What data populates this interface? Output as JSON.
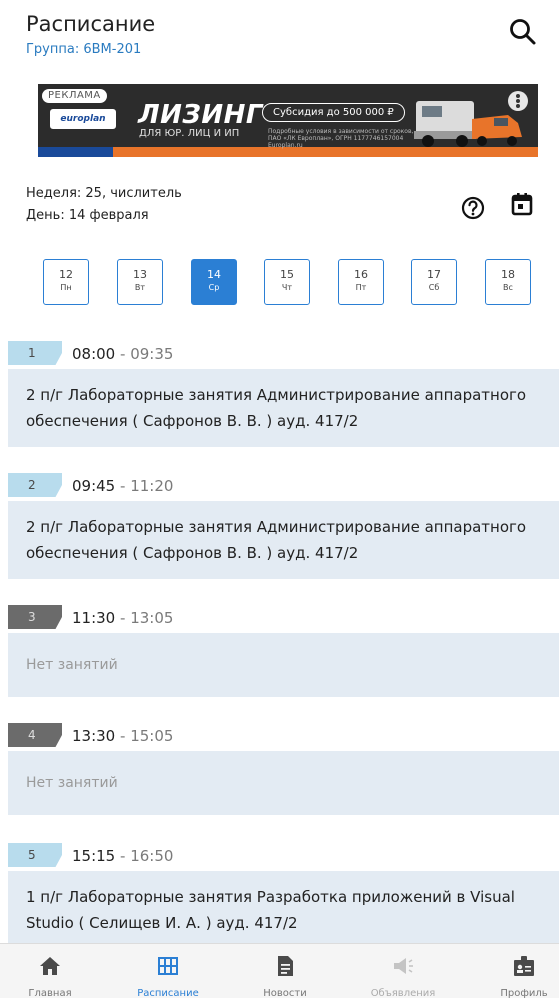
{
  "header": {
    "title": "Расписание",
    "group": "Группа: 6ВМ-201"
  },
  "ad": {
    "tag": "РЕКЛАМА",
    "logo": "europlan",
    "headline": "ЛИЗИНГ",
    "subline": "ДЛЯ ЮР. ЛИЦ И ИП",
    "pill": "Субсидия до 500 000 ₽",
    "fine_print": "Подробные условия в зависимости от сроков, ПАО «ЛК Европлан», ОГРН 1177746157004 Europlan.ru"
  },
  "week": {
    "week_line": "Неделя: 25, числитель",
    "day_line": "День: 14 февраля"
  },
  "days": [
    {
      "num": "12",
      "dow": "Пн"
    },
    {
      "num": "13",
      "dow": "Вт"
    },
    {
      "num": "14",
      "dow": "Ср"
    },
    {
      "num": "15",
      "dow": "Чт"
    },
    {
      "num": "16",
      "dow": "Пт"
    },
    {
      "num": "17",
      "dow": "Сб"
    },
    {
      "num": "18",
      "dow": "Вс"
    }
  ],
  "lessons": [
    {
      "num": "1",
      "start": "08:00",
      "sep": " - ",
      "end": "09:35",
      "text": "2 п/г Лабораторные занятия Администрирование аппаратного обеспечения ( Сафронов В. В. ) ауд. 417/2"
    },
    {
      "num": "2",
      "start": "09:45",
      "sep": " - ",
      "end": "11:20",
      "text": "2 п/г Лабораторные занятия Администрирование аппаратного обеспечения ( Сафронов В. В. ) ауд. 417/2"
    },
    {
      "num": "3",
      "start": "11:30",
      "sep": " - ",
      "end": "13:05",
      "text": "Нет занятий"
    },
    {
      "num": "4",
      "start": "13:30",
      "sep": " - ",
      "end": "15:05",
      "text": "Нет занятий"
    },
    {
      "num": "5",
      "start": "15:15",
      "sep": " - ",
      "end": "16:50",
      "text": "1 п/г Лабораторные занятия Разработка приложений в Visual Studio ( Селищев И. А. ) ауд. 417/2"
    }
  ],
  "nav": [
    {
      "label": "Главная"
    },
    {
      "label": "Расписание"
    },
    {
      "label": "Новости"
    },
    {
      "label": "Объявления"
    },
    {
      "label": "Профиль"
    }
  ],
  "colors": {
    "accent": "#2b7fd4",
    "lesson_bg": "#e3ebf3",
    "lesson_num_active": "#b8dced",
    "lesson_num_empty": "#6b6b6b"
  }
}
